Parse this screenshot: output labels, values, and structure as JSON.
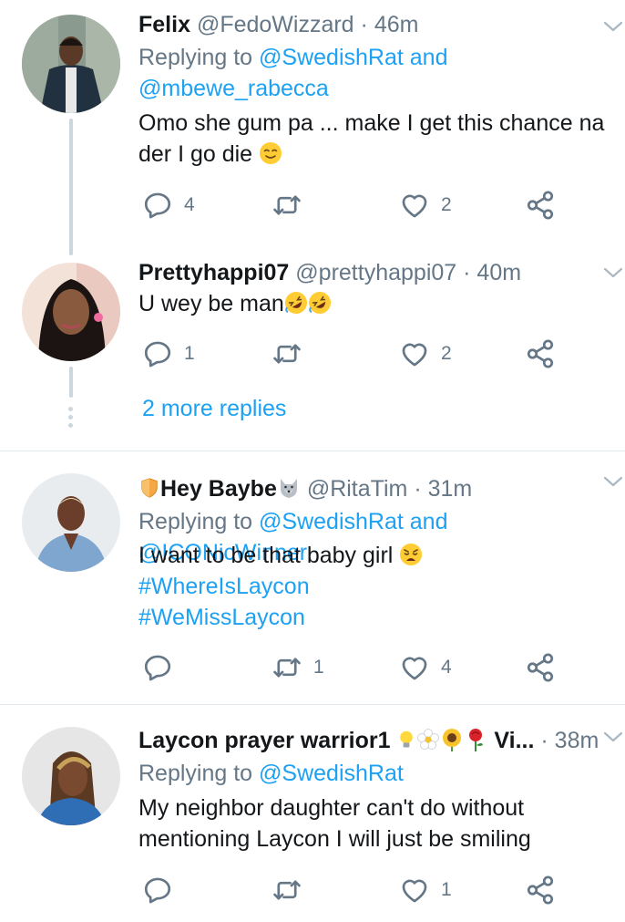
{
  "tweets": [
    {
      "name": "Felix",
      "handle": "@FedoWizzard",
      "sep": "·",
      "time": "46m",
      "reply_prefix": "Replying to",
      "reply_user1": "@SwedishRat",
      "reply_and": "and",
      "reply_user2": "@mbewe_rabecca",
      "text_line1": "Omo she gum pa ... make I get this chance na",
      "text_line2": "der I go die",
      "reply_count": "4",
      "like_count": "2"
    },
    {
      "name": "Prettyhappi07",
      "handle": "@prettyhappi07",
      "sep": "·",
      "time": "40m",
      "text_line1": "U wey be man",
      "reply_count": "1",
      "like_count": "2",
      "more_replies": "2 more replies"
    },
    {
      "name": "Hey Baybe",
      "handle": "@RitaTim",
      "sep": "·",
      "time": "31m",
      "reply_prefix": "Replying to",
      "reply_user1": "@SwedishRat",
      "reply_and": "and",
      "reply_user2": "@ICONicWinner",
      "text_line1": "I want to be that baby girl",
      "hashtag1": "#WhereIsLaycon",
      "hashtag2": "#WeMissLaycon",
      "retweet_count": "1",
      "like_count": "4"
    },
    {
      "name": "Laycon prayer warrior1",
      "name_suffix": "Vi...",
      "sep": "·",
      "time": "38m",
      "reply_prefix": "Replying to",
      "reply_user1": "@SwedishRat",
      "text_line1": "My neighbor daughter can't do without",
      "text_line2": "mentioning Laycon I will just be smiling",
      "like_count": "1"
    }
  ],
  "icons": [
    "reply-icon",
    "retweet-icon",
    "like-icon",
    "share-icon",
    "chevron-down-icon"
  ],
  "colors": {
    "link": "#1da1f2",
    "muted": "#657786",
    "text": "#14171a",
    "thread": "#ccd6dd"
  }
}
